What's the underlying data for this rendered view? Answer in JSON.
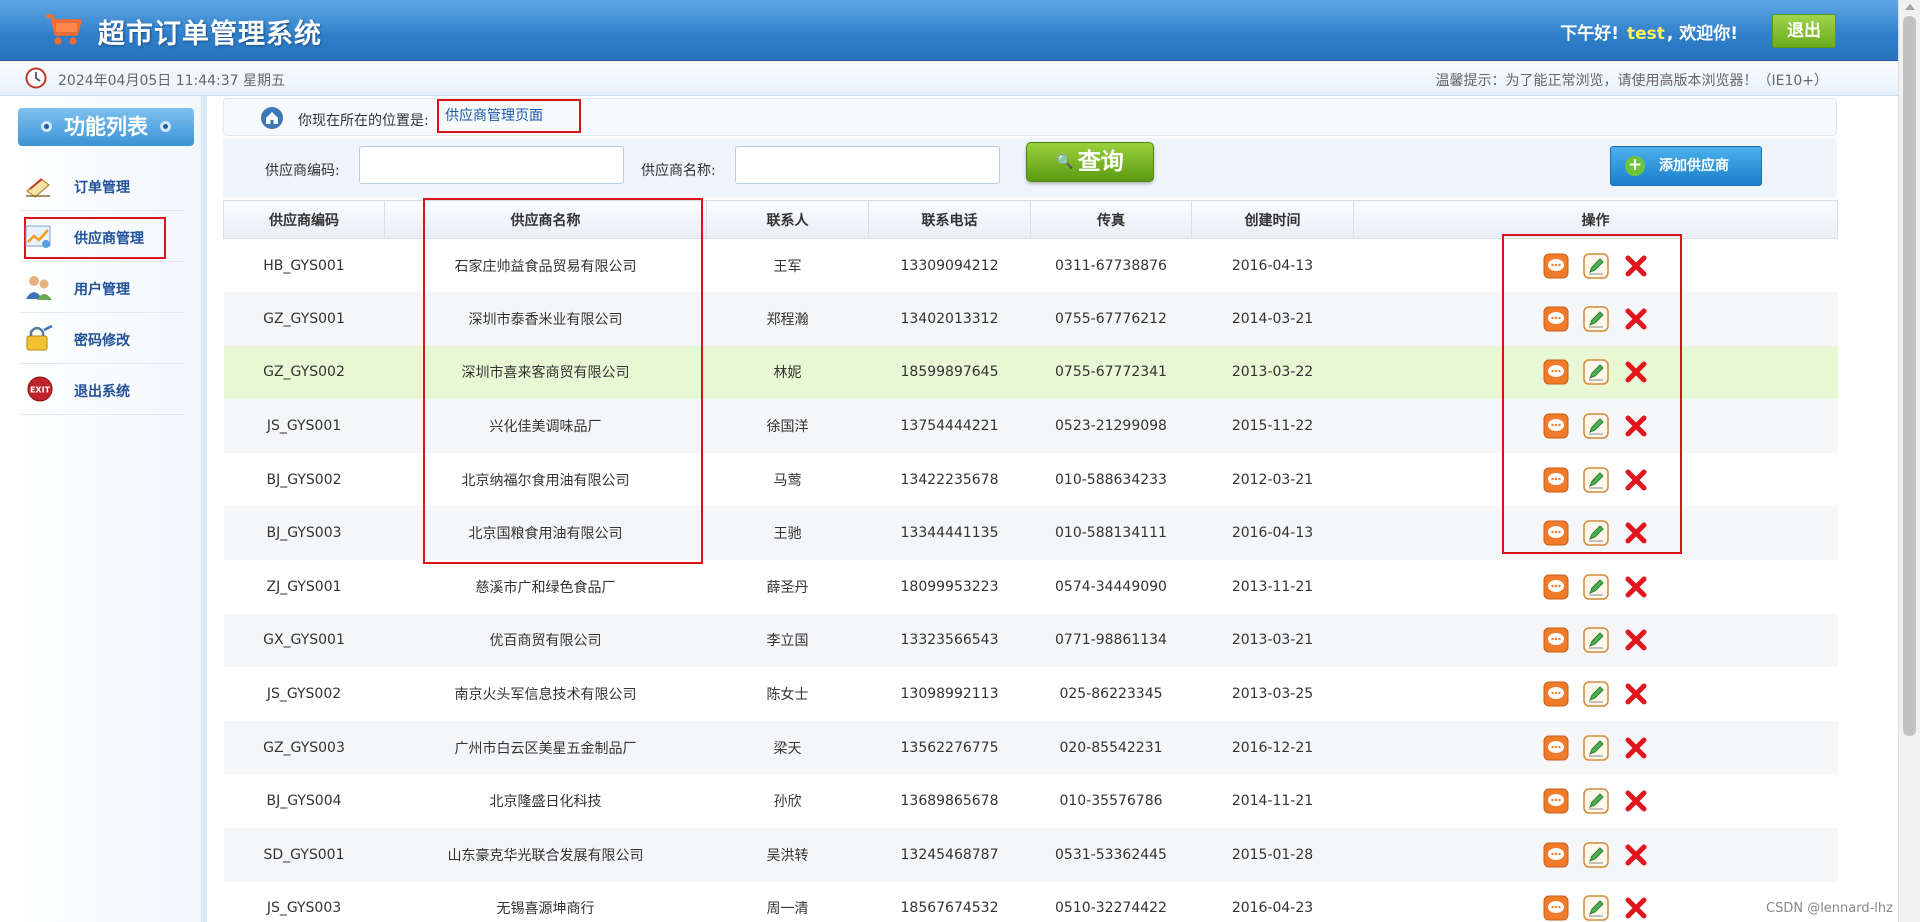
{
  "header": {
    "title": "超市订单管理系统",
    "greeting_prefix": "下午好!",
    "username": "test",
    "greeting_suffix": ", 欢迎你!",
    "logout_label": "退出"
  },
  "timebar": {
    "datetime": "2024年04月05日 11:44:37 星期五",
    "tip": "温馨提示：为了能正常浏览，请使用高版本浏览器！（IE10+）"
  },
  "sidebar": {
    "title": "功能列表",
    "items": [
      {
        "label": "订单管理",
        "icon": "order-icon"
      },
      {
        "label": "供应商管理",
        "icon": "supplier-icon"
      },
      {
        "label": "用户管理",
        "icon": "users-icon"
      },
      {
        "label": "密码修改",
        "icon": "password-icon"
      },
      {
        "label": "退出系统",
        "icon": "exit-icon"
      }
    ]
  },
  "location": {
    "label": "你现在所在的位置是:",
    "current": "供应商管理页面"
  },
  "search": {
    "code_label": "供应商编码:",
    "code_value": "",
    "name_label": "供应商名称:",
    "name_value": "",
    "query_label": "查询",
    "add_label": "添加供应商"
  },
  "table": {
    "headers": [
      "供应商编码",
      "供应商名称",
      "联系人",
      "联系电话",
      "传真",
      "创建时间",
      "操作"
    ],
    "rows": [
      [
        "HB_GYS001",
        "石家庄帅益食品贸易有限公司",
        "王军",
        "13309094212",
        "0311-67738876",
        "2016-04-13"
      ],
      [
        "GZ_GYS001",
        "深圳市泰香米业有限公司",
        "郑程瀚",
        "13402013312",
        "0755-67776212",
        "2014-03-21"
      ],
      [
        "GZ_GYS002",
        "深圳市喜来客商贸有限公司",
        "林妮",
        "18599897645",
        "0755-67772341",
        "2013-03-22"
      ],
      [
        "JS_GYS001",
        "兴化佳美调味品厂",
        "徐国洋",
        "13754444221",
        "0523-21299098",
        "2015-11-22"
      ],
      [
        "BJ_GYS002",
        "北京纳福尔食用油有限公司",
        "马莺",
        "13422235678",
        "010-588634233",
        "2012-03-21"
      ],
      [
        "BJ_GYS003",
        "北京国粮食用油有限公司",
        "王驰",
        "13344441135",
        "010-588134111",
        "2016-04-13"
      ],
      [
        "ZJ_GYS001",
        "慈溪市广和绿色食品厂",
        "薛圣丹",
        "18099953223",
        "0574-34449090",
        "2013-11-21"
      ],
      [
        "GX_GYS001",
        "优百商贸有限公司",
        "李立国",
        "13323566543",
        "0771-98861134",
        "2013-03-21"
      ],
      [
        "JS_GYS002",
        "南京火头军信息技术有限公司",
        "陈女士",
        "13098992113",
        "025-86223345",
        "2013-03-25"
      ],
      [
        "GZ_GYS003",
        "广州市白云区美星五金制品厂",
        "梁天",
        "13562276775",
        "020-85542231",
        "2016-12-21"
      ],
      [
        "BJ_GYS004",
        "北京隆盛日化科技",
        "孙欣",
        "13689865678",
        "010-35576786",
        "2014-11-21"
      ],
      [
        "SD_GYS001",
        "山东豪克华光联合发展有限公司",
        "吴洪转",
        "13245468787",
        "0531-53362445",
        "2015-01-28"
      ],
      [
        "JS_GYS003",
        "无锡喜源坤商行",
        "周一清",
        "18567674532",
        "0510-32274422",
        "2016-04-23"
      ]
    ]
  },
  "watermark": "CSDN @lennard-lhz",
  "colors": {
    "header_blue": "#2e7fc9",
    "accent_green": "#6aab1e",
    "highlight_red": "#d9121b",
    "hover_row": "#e8f7d4"
  }
}
